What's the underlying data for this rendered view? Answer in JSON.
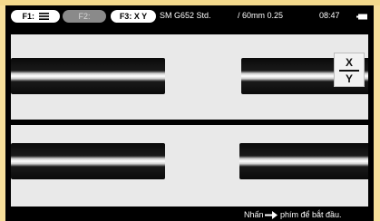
{
  "statusbar": {
    "f1_label": "F1:",
    "f2_label": "F2:",
    "f3_label": "F3: X Y",
    "fiber_type": "SM G652 Std.",
    "distance": "/ 60mm 0.25",
    "time": "08:47",
    "f1_icon": "menu-icon",
    "battery_icon": "battery-icon"
  },
  "view": {
    "xy_button": {
      "x": "X",
      "y": "Y"
    }
  },
  "hint": {
    "pre": "Nhấn",
    "post": "phím để bắt đầu.",
    "arrow_icon": "arrow-right-icon"
  },
  "colors": {
    "bezel": "#f7df9a",
    "screen": "#000000",
    "view_background": "#e9e9e9",
    "f2_disabled": "#8a8a8a"
  }
}
